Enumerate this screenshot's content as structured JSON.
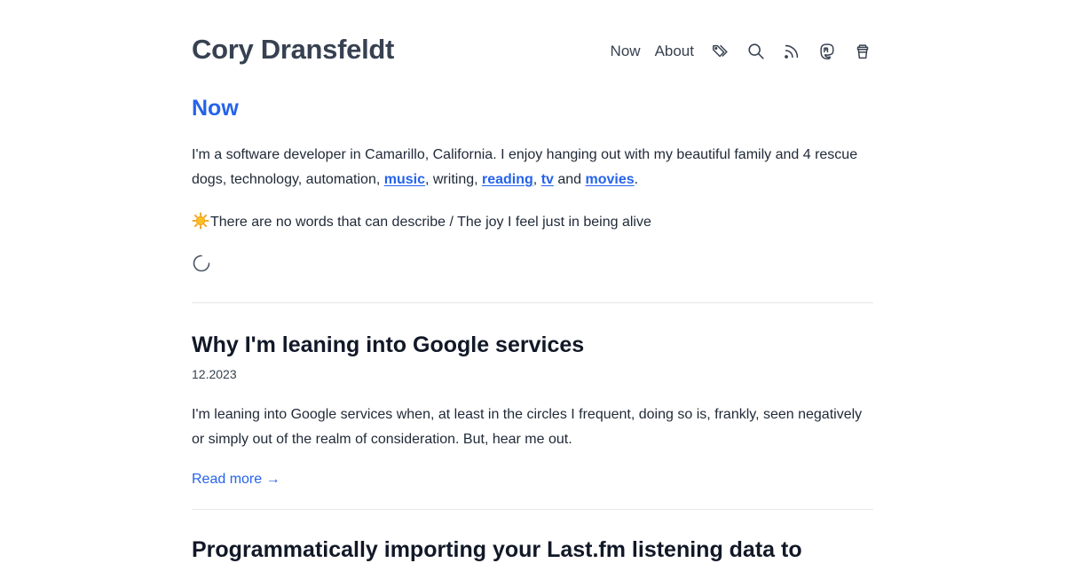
{
  "site": {
    "title": "Cory Dransfeldt"
  },
  "nav": {
    "links": [
      {
        "label": "Now"
      },
      {
        "label": "About"
      }
    ],
    "icons": [
      "tags-icon",
      "search-icon",
      "rss-icon",
      "mastodon-icon",
      "coffee-cup-icon"
    ]
  },
  "now": {
    "heading": "Now",
    "intro_parts": {
      "p1": "I'm a software developer in Camarillo, California. I enjoy hanging out with my beautiful family and 4 rescue dogs, technology, automation, ",
      "link_music": "music",
      "p2": ", writing, ",
      "link_reading": "reading",
      "p3": ", ",
      "link_tv": "tv",
      "p4": " and ",
      "link_movies": "movies",
      "p5": "."
    },
    "lyric": "There are no words that can describe / The joy I feel just in being alive"
  },
  "posts": [
    {
      "title": "Why I'm leaning into Google services",
      "date": "12.2023",
      "excerpt": "I'm leaning into Google services when, at least in the circles I frequent, doing so is, frankly, seen negatively or simply out of the realm of consideration. But, hear me out.",
      "read_more": "Read more →"
    },
    {
      "title": "Programmatically importing your Last.fm listening data to"
    }
  ],
  "colors": {
    "accent": "#2563eb",
    "text": "#1f2937",
    "heading": "#111827",
    "divider": "#e5e7eb"
  }
}
